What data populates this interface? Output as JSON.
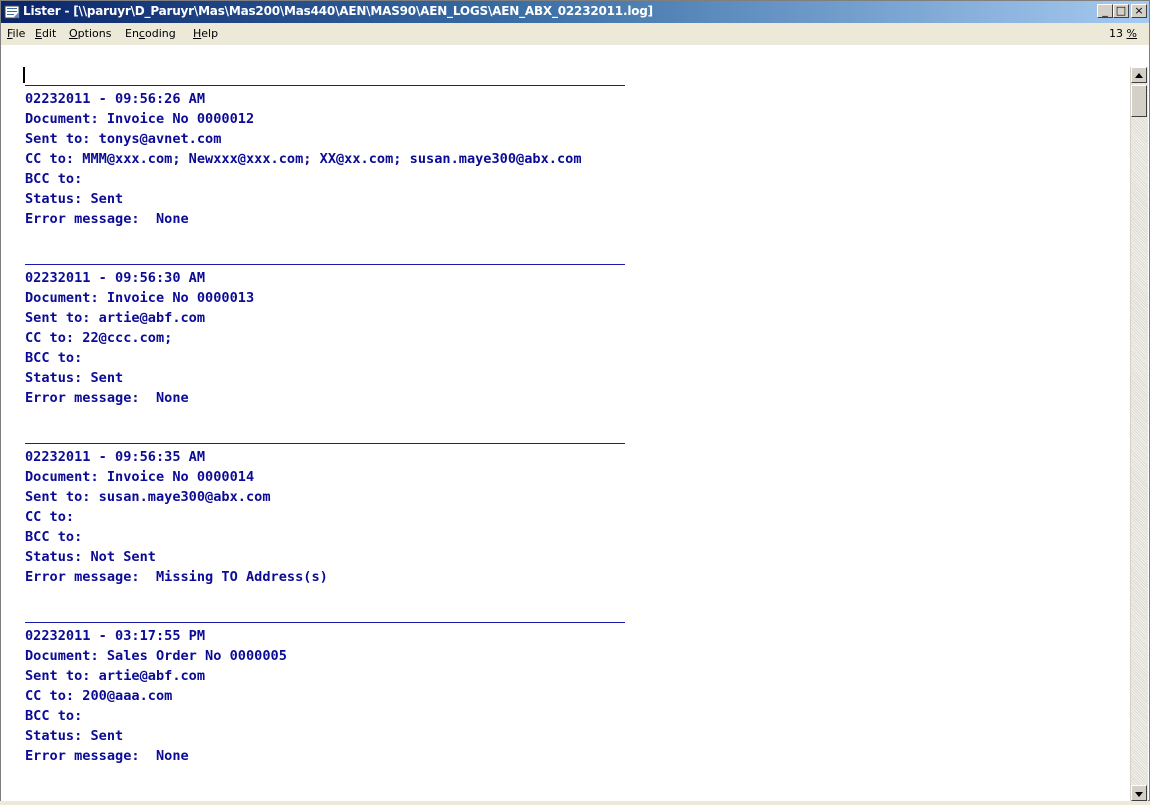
{
  "window": {
    "title": "Lister - [\\\\paruyr\\D_Paruyr\\Mas\\Mas200\\Mas440\\AEN\\MAS90\\AEN_LOGS\\AEN_ABX_02232011.log]",
    "minimize_label": "_",
    "maximize_label": "□",
    "close_label": "×"
  },
  "menu": {
    "items": [
      {
        "first": "F",
        "rest": "ile"
      },
      {
        "first": "E",
        "rest": "dit"
      },
      {
        "first": "O",
        "rest": "ptions"
      },
      {
        "pre": "En",
        "first": "c",
        "rest": "oding"
      },
      {
        "first": "H",
        "rest": "elp"
      }
    ],
    "zoom_number": "13 ",
    "zoom_unit": "%"
  },
  "log": {
    "entries": [
      {
        "timestamp": "02232011 - 09:56:26 AM",
        "document": "Document: Invoice No 0000012",
        "sent_to": "Sent to: tonys@avnet.com",
        "cc": "CC to: MMM@xxx.com; Newxxx@xxx.com; XX@xx.com; susan.maye300@abx.com",
        "bcc": "BCC to:",
        "status": "Status: Sent",
        "error": "Error message:  None"
      },
      {
        "timestamp": "02232011 - 09:56:30 AM",
        "document": "Document: Invoice No 0000013",
        "sent_to": "Sent to: artie@abf.com",
        "cc": "CC to: 22@ccc.com;",
        "bcc": "BCC to:",
        "status": "Status: Sent",
        "error": "Error message:  None"
      },
      {
        "timestamp": "02232011 - 09:56:35 AM",
        "document": "Document: Invoice No 0000014",
        "sent_to": "Sent to: susan.maye300@abx.com",
        "cc": "CC to:",
        "bcc": "BCC to:",
        "status": "Status: Not Sent",
        "error": "Error message:  Missing TO Address(s)"
      },
      {
        "timestamp": "02232011 - 03:17:55 PM",
        "document": "Document: Sales Order No 0000005",
        "sent_to": "Sent to: artie@abf.com",
        "cc": "CC to: 200@aaa.com",
        "bcc": "BCC to:",
        "status": "Status: Sent",
        "error": "Error message:  None"
      }
    ]
  },
  "colors": {
    "title_gradient_start": "#0a246a",
    "title_gradient_end": "#a6caf0",
    "log_text": "#0b0b96",
    "separator": "#1a1aaa"
  }
}
